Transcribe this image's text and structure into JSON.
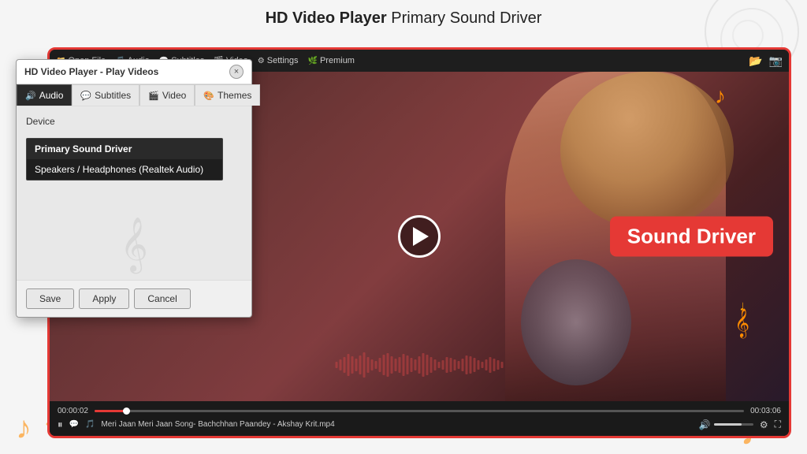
{
  "page": {
    "title_strong": "HD Video Player",
    "title_rest": " Primary Sound Driver"
  },
  "toolbar": {
    "items": [
      {
        "label": "Open File",
        "icon": "📁"
      },
      {
        "label": "Audio",
        "icon": "🎵"
      },
      {
        "label": "Subtitles",
        "icon": "💬"
      },
      {
        "label": "Video",
        "icon": "🎬"
      },
      {
        "label": "Settings",
        "icon": "⚙"
      },
      {
        "label": "Premium",
        "icon": "🌿"
      }
    ]
  },
  "dialog": {
    "title": "HD Video Player - Play Videos",
    "close_icon": "×",
    "tabs": [
      {
        "label": "Audio",
        "icon": "🔊",
        "active": true
      },
      {
        "label": "Subtitles",
        "icon": "💬",
        "active": false
      },
      {
        "label": "Video",
        "icon": "🎬",
        "active": false
      },
      {
        "label": "Themes",
        "icon": "🎨",
        "active": false
      }
    ],
    "device_label": "Device",
    "dropdown": {
      "options": [
        {
          "label": "Primary Sound Driver",
          "selected": true
        },
        {
          "label": "Speakers / Headphones (Realtek Audio)",
          "selected": false
        }
      ]
    }
  },
  "footer_buttons": {
    "save": "Save",
    "apply": "Apply",
    "cancel": "Cancel"
  },
  "sound_driver_badge": "Sound Driver",
  "controls": {
    "time_start": "00:00:02",
    "time_end": "00:03:06",
    "file_name": "Meri Jaan Meri Jaan Song- Bachchhan Paandey - Akshay Krit.mp4"
  },
  "colors": {
    "accent": "#e53935",
    "orange": "#ff8c00",
    "dark": "#1e1e1e"
  }
}
